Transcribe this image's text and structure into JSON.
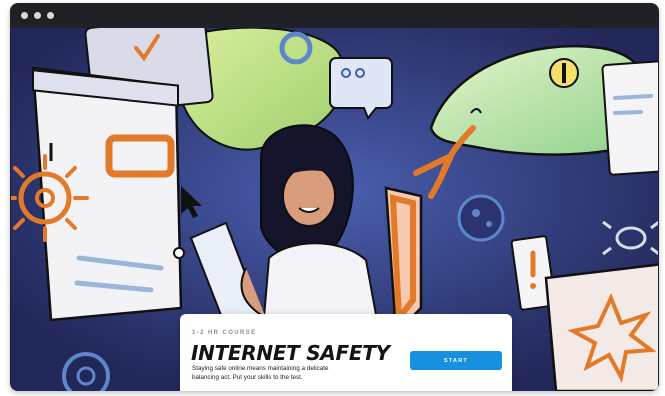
{
  "window": {
    "controls": [
      "window-dot",
      "window-dot",
      "window-dot"
    ]
  },
  "hero": {
    "illustration": "internet safety illustration: girl with laptop and shield, snake, browser windows, virus icons, cursor"
  },
  "course": {
    "duration_label": "1-2 HR COURSE",
    "title": "INTERNET SAFETY",
    "description": "Staying safe online means maintaining a delicate balancing act. Put your skills to the test.",
    "start_label": "START"
  },
  "colors": {
    "background": "#232a5b",
    "accent": "#1691df",
    "orange": "#e37a2a",
    "snake": "#b9e39a",
    "window_frame": "#1f2126"
  }
}
